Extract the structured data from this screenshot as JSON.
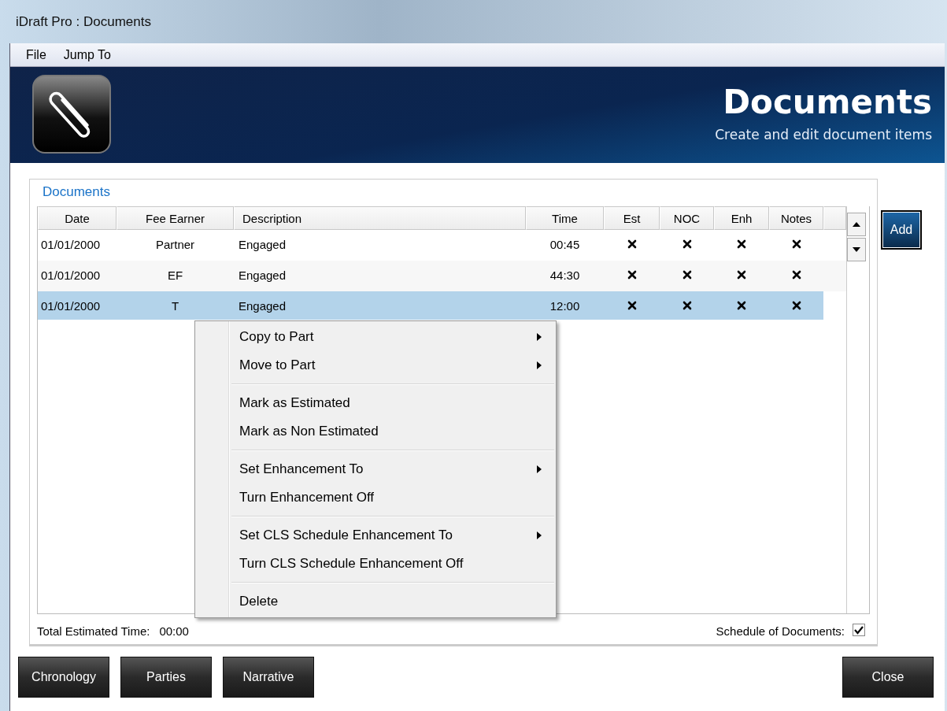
{
  "window": {
    "title": "iDraft Pro : Documents"
  },
  "menu_bar": [
    "File",
    "Jump To"
  ],
  "banner": {
    "title": "Documents",
    "subtitle": "Create and edit document items"
  },
  "group": {
    "title": "Documents"
  },
  "table": {
    "columns": [
      "Date",
      "Fee Earner",
      "Description",
      "Time",
      "Est",
      "NOC",
      "Enh",
      "Notes"
    ],
    "rows": [
      {
        "date": "01/01/2000",
        "fee_earner": "Partner",
        "description": "Engaged",
        "time": "00:45",
        "est": false,
        "noc": false,
        "enh": false,
        "notes": false,
        "selected": false
      },
      {
        "date": "01/01/2000",
        "fee_earner": "EF",
        "description": "Engaged",
        "time": "44:30",
        "est": false,
        "noc": false,
        "enh": false,
        "notes": false,
        "selected": false
      },
      {
        "date": "01/01/2000",
        "fee_earner": "T",
        "description": "Engaged",
        "time": "12:00",
        "est": false,
        "noc": false,
        "enh": false,
        "notes": false,
        "selected": true
      }
    ]
  },
  "add_button": "Add",
  "context_menu": {
    "groups": [
      [
        {
          "label": "Copy to Part",
          "submenu": true
        },
        {
          "label": "Move to Part",
          "submenu": true
        }
      ],
      [
        {
          "label": "Mark as Estimated",
          "submenu": false
        },
        {
          "label": "Mark as Non Estimated",
          "submenu": false
        }
      ],
      [
        {
          "label": "Set Enhancement To",
          "submenu": true
        },
        {
          "label": "Turn Enhancement Off",
          "submenu": false
        }
      ],
      [
        {
          "label": "Set CLS Schedule Enhancement To",
          "submenu": true
        },
        {
          "label": "Turn CLS Schedule Enhancement Off",
          "submenu": false
        }
      ],
      [
        {
          "label": "Delete",
          "submenu": false
        }
      ]
    ]
  },
  "total_estimated_time": {
    "label": "Total Estimated Time:",
    "value": "00:00"
  },
  "schedule_of_documents": {
    "label": "Schedule of Documents:",
    "checked": true
  },
  "nav_buttons": [
    "Chronology",
    "Parties",
    "Narrative"
  ],
  "close_button": "Close"
}
